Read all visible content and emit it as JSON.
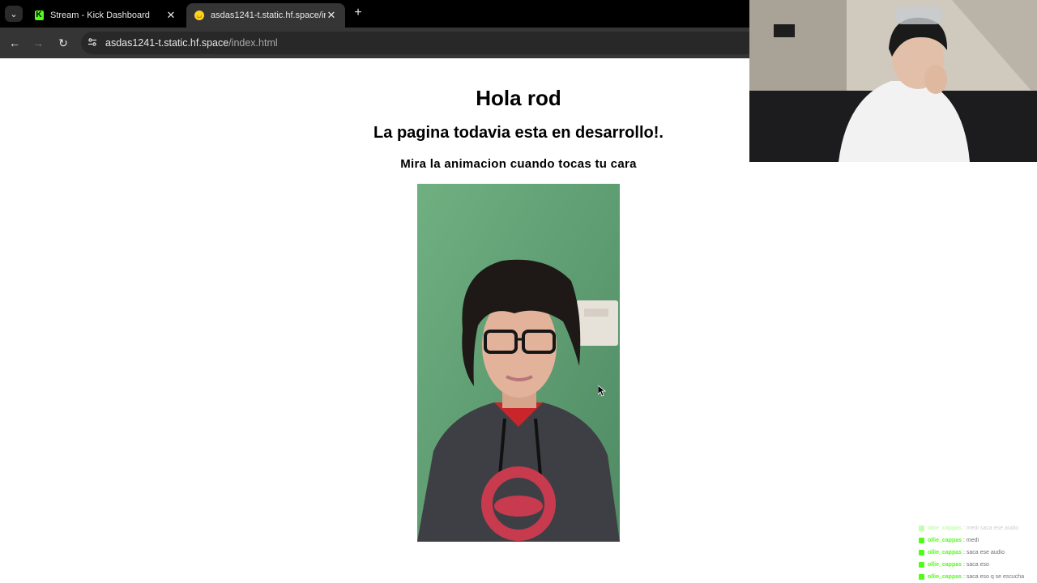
{
  "browser": {
    "tabs": [
      {
        "title": "Stream - Kick Dashboard",
        "favicon": "kick-icon",
        "active": false
      },
      {
        "title": "asdas1241-t.static.hf.space/index.html",
        "favicon": "huggingface-icon",
        "active": true
      }
    ],
    "url": {
      "host": "asdas1241-t.static.hf.space",
      "path": "/index.html"
    }
  },
  "page": {
    "heading": "Hola rod",
    "subheading": "La pagina todavia esta en desarrollo!.",
    "caption": "Mira la animacion cuando tocas tu cara"
  },
  "chat": {
    "lines": [
      {
        "user": "ollie_cappas",
        "message": "medi saca ese audio",
        "faded": true
      },
      {
        "user": "ollie_cappas",
        "message": "medi",
        "faded": false
      },
      {
        "user": "ollie_cappas",
        "message": "saca ese audio",
        "faded": false
      },
      {
        "user": "ollie_cappas",
        "message": "saca eso",
        "faded": false
      },
      {
        "user": "ollie_cappas",
        "message": "saca eso q se escucha",
        "faded": false
      }
    ]
  },
  "colors": {
    "kick_green": "#53fc18",
    "photo_background": "#5e9c72"
  }
}
